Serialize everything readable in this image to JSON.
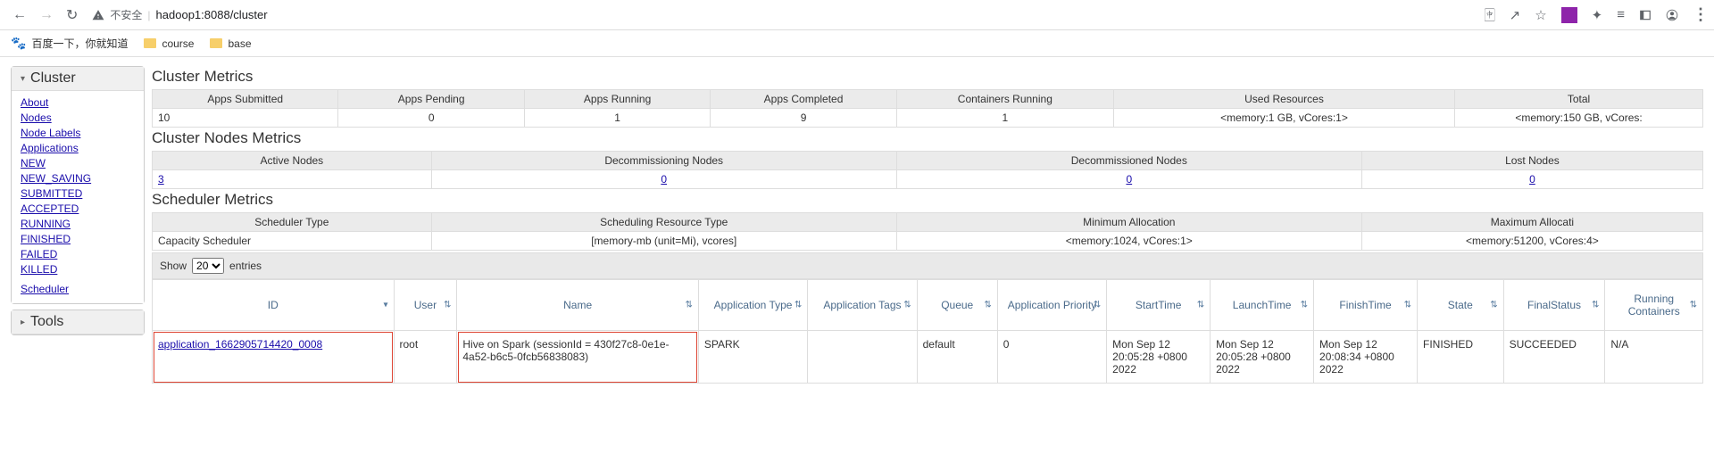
{
  "browser": {
    "security_label": "不安全",
    "url": "hadoop1:8088/cluster"
  },
  "bookmarks": {
    "b1": "百度一下，你就知道",
    "b2": "course",
    "b3": "base"
  },
  "sidebar": {
    "cluster_label": "Cluster",
    "tools_label": "Tools",
    "items": {
      "about": "About",
      "nodes": "Nodes",
      "node_labels": "Node Labels",
      "applications": "Applications",
      "scheduler": "Scheduler"
    },
    "app_states": {
      "new": "NEW",
      "new_saving": "NEW_SAVING",
      "submitted": "SUBMITTED",
      "accepted": "ACCEPTED",
      "running": "RUNNING",
      "finished": "FINISHED",
      "failed": "FAILED",
      "killed": "KILLED"
    }
  },
  "sections": {
    "cluster_metrics": "Cluster Metrics",
    "cluster_nodes_metrics": "Cluster Nodes Metrics",
    "scheduler_metrics": "Scheduler Metrics"
  },
  "cluster_metrics": {
    "headers": {
      "apps_submitted": "Apps Submitted",
      "apps_pending": "Apps Pending",
      "apps_running": "Apps Running",
      "apps_completed": "Apps Completed",
      "containers_running": "Containers Running",
      "used_resources": "Used Resources",
      "total": "Total "
    },
    "row": {
      "apps_submitted": "10",
      "apps_pending": "0",
      "apps_running": "1",
      "apps_completed": "9",
      "containers_running": "1",
      "used_resources": "<memory:1 GB, vCores:1>",
      "total": "<memory:150 GB, vCores:"
    }
  },
  "nodes_metrics": {
    "headers": {
      "active": "Active Nodes",
      "decommissioning": "Decommissioning Nodes",
      "decommissioned": "Decommissioned Nodes",
      "lost": "Lost Nodes"
    },
    "row": {
      "active": "3",
      "decommissioning": "0",
      "decommissioned": "0",
      "lost": "0"
    }
  },
  "scheduler_metrics": {
    "headers": {
      "type": "Scheduler Type",
      "resource_type": "Scheduling Resource Type",
      "min_alloc": "Minimum Allocation",
      "max_alloc": "Maximum Allocati"
    },
    "row": {
      "type": "Capacity Scheduler",
      "resource_type": "[memory-mb (unit=Mi), vcores]",
      "min_alloc": "<memory:1024, vCores:1>",
      "max_alloc": "<memory:51200, vCores:4>"
    }
  },
  "entries": {
    "show": "Show",
    "count": "20",
    "suffix": "entries"
  },
  "apps_table": {
    "headers": {
      "id": "ID",
      "user": "User",
      "name": "Name",
      "app_type": "Application Type",
      "app_tags": "Application Tags",
      "queue": "Queue",
      "priority": "Application Priority",
      "start": "StartTime",
      "launch": "LaunchTime",
      "finish": "FinishTime",
      "state": "State",
      "final": "FinalStatus",
      "running_containers": "Running Containers"
    },
    "row": {
      "id": "application_1662905714420_0008",
      "user": "root",
      "name": "Hive on Spark (sessionId = 430f27c8-0e1e-4a52-b6c5-0fcb56838083)",
      "app_type": "SPARK",
      "app_tags": "",
      "queue": "default",
      "priority": "0",
      "start": "Mon Sep 12 20:05:28 +0800 2022",
      "launch": "Mon Sep 12 20:05:28 +0800 2022",
      "finish": "Mon Sep 12 20:08:34 +0800 2022",
      "state": "FINISHED",
      "final": "SUCCEEDED",
      "running_containers": "N/A"
    }
  }
}
